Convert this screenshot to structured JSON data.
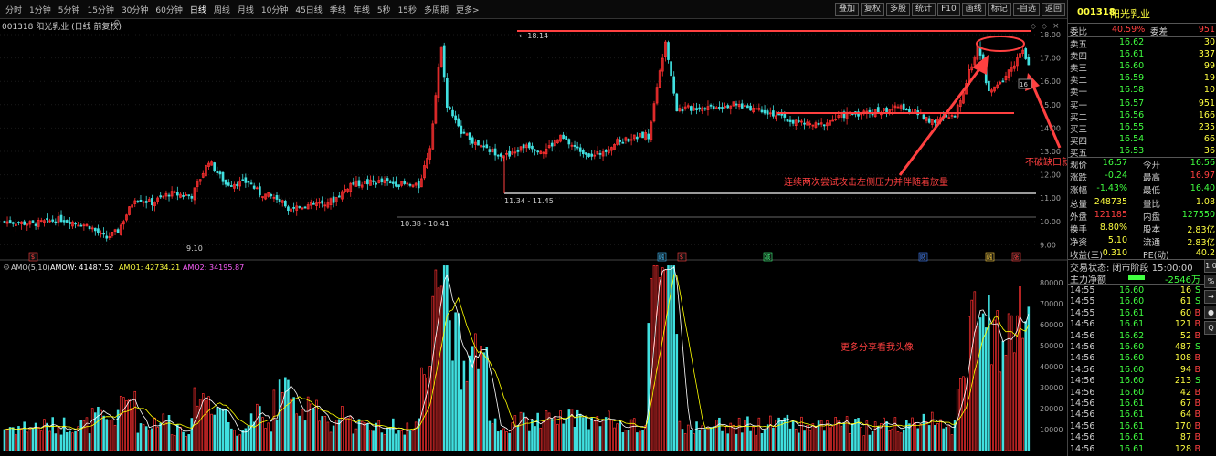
{
  "periods": [
    "分时",
    "1分钟",
    "5分钟",
    "15分钟",
    "30分钟",
    "60分钟",
    "日线",
    "周线",
    "月线",
    "10分钟",
    "45日线",
    "季线",
    "年线",
    "5秒",
    "15秒",
    "多周期",
    "更多>"
  ],
  "active_period": "日线",
  "tools": [
    "叠加",
    "复权",
    "多股",
    "统计",
    "F10",
    "画线",
    "标记",
    "-自选",
    "返回"
  ],
  "stock_title": "001318 阳光乳业 (日线 前复权)",
  "amo_legend": {
    "title": "AMO(5,10)",
    "amow": "AMOW: 41487.52",
    "amo1": "AMO1: 42734.21",
    "amo2": "AMO2: 34195.87"
  },
  "annotations": {
    "high_label": "18.14",
    "range_label": "11.34 - 11.45",
    "range_label2": "10.38 - 10.41",
    "low_label": "9.10",
    "note1": "连续两次尝试攻击左侧压力并伴随着放量",
    "note2": "不破缺口就持股",
    "note3": "更多分享看我头像"
  },
  "price_axis": [
    "18.00",
    "17.00",
    "16.00",
    "15.00",
    "14.00",
    "13.00",
    "12.00",
    "11.00",
    "10.00",
    "9.00"
  ],
  "vol_axis": [
    "80000",
    "70000",
    "60000",
    "50000",
    "40000",
    "30000",
    "20000",
    "10000"
  ],
  "events": [
    {
      "label": "$",
      "color": "#ff4040"
    },
    {
      "label": "融",
      "color": "#40c0ff"
    },
    {
      "label": "$",
      "color": "#ff4040"
    },
    {
      "label": "减",
      "color": "#40ff80"
    },
    {
      "label": "财",
      "color": "#4080ff"
    },
    {
      "label": "融",
      "color": "#ffd040"
    },
    {
      "label": "涨",
      "color": "#ff4040"
    }
  ],
  "quote": {
    "code": "001318",
    "name": "阳光乳业",
    "wei_bi_label": "委比",
    "wei_bi": "40.59%",
    "wei_cha_label": "委差",
    "wei_cha": "951",
    "asks": [
      {
        "label": "卖五",
        "price": "16.62",
        "vol": "30"
      },
      {
        "label": "卖四",
        "price": "16.61",
        "vol": "337"
      },
      {
        "label": "卖三",
        "price": "16.60",
        "vol": "99"
      },
      {
        "label": "卖二",
        "price": "16.59",
        "vol": "19"
      },
      {
        "label": "卖一",
        "price": "16.58",
        "vol": "10"
      }
    ],
    "bids": [
      {
        "label": "买一",
        "price": "16.57",
        "vol": "951"
      },
      {
        "label": "买二",
        "price": "16.56",
        "vol": "166"
      },
      {
        "label": "买三",
        "price": "16.55",
        "vol": "235"
      },
      {
        "label": "买四",
        "price": "16.54",
        "vol": "66"
      },
      {
        "label": "买五",
        "price": "16.53",
        "vol": "36"
      }
    ],
    "stats": [
      {
        "l1": "现价",
        "v1": "16.57",
        "l2": "今开",
        "v2": "16.56",
        "c1": "#40ff40",
        "c2": "#40ff40"
      },
      {
        "l1": "涨跌",
        "v1": "-0.24",
        "l2": "最高",
        "v2": "16.97",
        "c1": "#40ff40",
        "c2": "#ff4040"
      },
      {
        "l1": "涨幅",
        "v1": "-1.43%",
        "l2": "最低",
        "v2": "16.40",
        "c1": "#40ff40",
        "c2": "#40ff40"
      },
      {
        "l1": "总量",
        "v1": "248735",
        "l2": "量比",
        "v2": "1.08",
        "c1": "#ffff40",
        "c2": "#ffff40"
      },
      {
        "l1": "外盘",
        "v1": "121185",
        "l2": "内盘",
        "v2": "127550",
        "c1": "#ff4040",
        "c2": "#40ff40"
      },
      {
        "l1": "换手",
        "v1": "8.80%",
        "l2": "股本",
        "v2": "2.83亿",
        "c1": "#ffff40",
        "c2": "#ffff40"
      },
      {
        "l1": "净资",
        "v1": "5.10",
        "l2": "流通",
        "v2": "2.83亿",
        "c1": "#ffff40",
        "c2": "#ffff40"
      },
      {
        "l1": "收益(三)",
        "v1": "0.310",
        "l2": "PE(动)",
        "v2": "40.2",
        "c1": "#ffff40",
        "c2": "#ffff40"
      }
    ],
    "trade_state": "交易状态: 闭市阶段 15:00:00",
    "main_flow_label": "主力净额",
    "main_flow": "-2546万"
  },
  "ticks": [
    {
      "t": "14:55",
      "p": "16.60",
      "v": "16",
      "s": "S"
    },
    {
      "t": "14:55",
      "p": "16.60",
      "v": "61",
      "s": "S"
    },
    {
      "t": "14:55",
      "p": "16.61",
      "v": "60",
      "s": "B"
    },
    {
      "t": "14:56",
      "p": "16.61",
      "v": "121",
      "s": "B"
    },
    {
      "t": "14:56",
      "p": "16.62",
      "v": "52",
      "s": "B"
    },
    {
      "t": "14:56",
      "p": "16.60",
      "v": "487",
      "s": "S"
    },
    {
      "t": "14:56",
      "p": "16.60",
      "v": "108",
      "s": "B"
    },
    {
      "t": "14:56",
      "p": "16.60",
      "v": "94",
      "s": "B"
    },
    {
      "t": "14:56",
      "p": "16.60",
      "v": "213",
      "s": "S"
    },
    {
      "t": "14:56",
      "p": "16.60",
      "v": "42",
      "s": "B"
    },
    {
      "t": "14:56",
      "p": "16.61",
      "v": "67",
      "s": "B"
    },
    {
      "t": "14:56",
      "p": "16.61",
      "v": "64",
      "s": "B"
    },
    {
      "t": "14:56",
      "p": "16.61",
      "v": "170",
      "s": "B"
    },
    {
      "t": "14:56",
      "p": "16.61",
      "v": "87",
      "s": "B"
    },
    {
      "t": "14:56",
      "p": "16.61",
      "v": "128",
      "s": "B"
    }
  ],
  "side_buttons": [
    "1.0",
    "%",
    "→",
    "●",
    "Q"
  ],
  "colors": {
    "up": "#ff3030",
    "down": "#40e0e0",
    "level_line": "#ff4040",
    "support_line": "#9a9a9a",
    "ma1": "#ffffff",
    "ma2": "#ffff00"
  }
}
